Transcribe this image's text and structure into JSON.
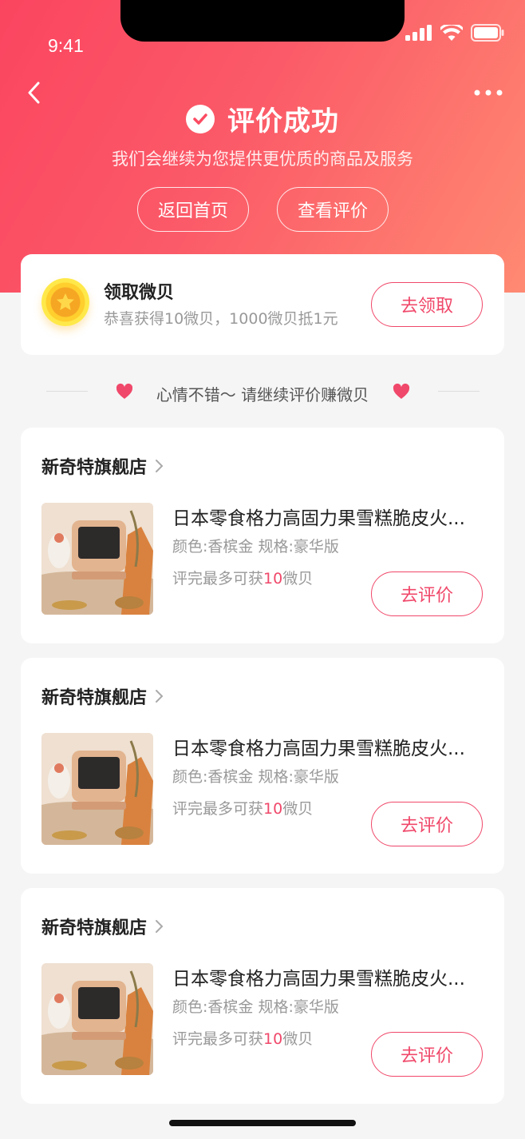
{
  "status_bar": {
    "time": "9:41"
  },
  "header": {
    "title": "评价成功",
    "subtitle": "我们会继续为您提供更优质的商品及服务",
    "home_button": "返回首页",
    "view_button": "查看评价"
  },
  "reward": {
    "title": "领取微贝",
    "desc": "恭喜获得10微贝，1000微贝抵1元",
    "button": "去领取"
  },
  "divider": {
    "text": "心情不错～ 请继续评价赚微贝"
  },
  "orders": [
    {
      "store": "新奇特旗舰店",
      "title": "日本零食格力高固力果雪糕脆皮火...",
      "spec": "颜色:香槟金  规格:豪华版",
      "reward_prefix": "评完最多可获",
      "reward_amount": "10",
      "reward_suffix": "微贝",
      "button": "去评价"
    },
    {
      "store": "新奇特旗舰店",
      "title": "日本零食格力高固力果雪糕脆皮火...",
      "spec": "颜色:香槟金  规格:豪华版",
      "reward_prefix": "评完最多可获",
      "reward_amount": "10",
      "reward_suffix": "微贝",
      "button": "去评价"
    },
    {
      "store": "新奇特旗舰店",
      "title": "日本零食格力高固力果雪糕脆皮火...",
      "spec": "颜色:香槟金  规格:豪华版",
      "reward_prefix": "评完最多可获",
      "reward_amount": "10",
      "reward_suffix": "微贝",
      "button": "去评价"
    }
  ],
  "colors": {
    "accent": "#f0486a",
    "hero_start": "#fb4560",
    "hero_end": "#ff8a72"
  }
}
